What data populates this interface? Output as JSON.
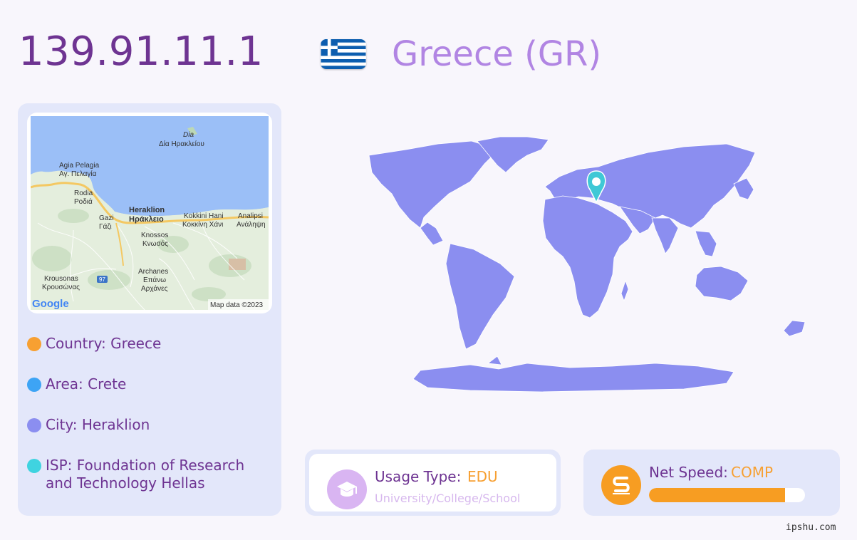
{
  "ip_address": "139.91.11.1",
  "country_title": "Greece (GR)",
  "flag_icon": "greece-flag-icon",
  "map": {
    "attribution": "Map data ©2023",
    "brand": "Google",
    "sea_label_latin": "Dia",
    "sea_label_greek": "Δία Ηρακλείου",
    "places": [
      {
        "latin": "Agia Pelagia",
        "greek": "Αγ. Πελαγία"
      },
      {
        "latin": "Rodia",
        "greek": "Ροδιά"
      },
      {
        "latin": "Gazi",
        "greek": "Γάζι"
      },
      {
        "latin": "Heraklion",
        "greek": "Ηράκλειο"
      },
      {
        "latin": "Kokkini Hani",
        "greek": "Κοκκίνη Χάνι"
      },
      {
        "latin": "Analipsi",
        "greek": "Ανάληψη"
      },
      {
        "latin": "Knossos",
        "greek": "Κνωσός"
      },
      {
        "latin": "Archanes",
        "greek": "Επάνω Αρχάνες"
      },
      {
        "latin": "Krousonas",
        "greek": "Κρουσώνας"
      }
    ],
    "road_number": "97"
  },
  "info": [
    {
      "text": "Country: Greece",
      "color": "#f7a032"
    },
    {
      "text": "Area: Crete",
      "color": "#3da4f5"
    },
    {
      "text": "City: Heraklion",
      "color": "#8b8ef0"
    },
    {
      "text": "ISP: Foundation of Research and Technology Hellas",
      "color": "#3fd3e0"
    }
  ],
  "usage": {
    "label": "Usage Type:",
    "value": "EDU",
    "description": "University/College/School",
    "icon": "graduation-cap-icon"
  },
  "speed": {
    "label": "Net Speed:",
    "value": "COMP",
    "level": 0.87,
    "icon": "speed-s-icon"
  },
  "watermark": "ipshu.com",
  "colors": {
    "map_land": "#8b8ef0",
    "pin": "#3fc8d6",
    "accent_orange": "#f79d22"
  }
}
